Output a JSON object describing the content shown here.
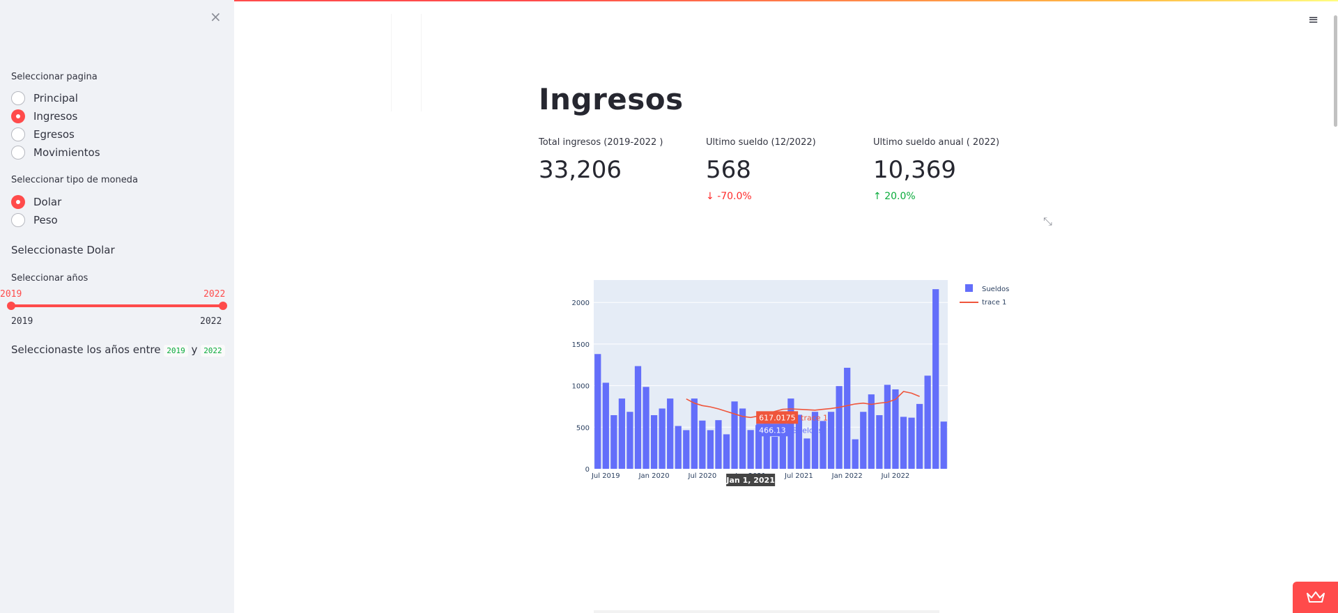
{
  "sidebar": {
    "close_label": "×",
    "page_selector": {
      "label": "Seleccionar pagina",
      "options": [
        "Principal",
        "Ingresos",
        "Egresos",
        "Movimientos"
      ],
      "selected": "Ingresos"
    },
    "currency_selector": {
      "label": "Seleccionar tipo de moneda",
      "options": [
        "Dolar",
        "Peso"
      ],
      "selected": "Dolar"
    },
    "currency_message": "Seleccionaste Dolar",
    "years_slider": {
      "label": "Seleccionar años",
      "value_low": "2019",
      "value_high": "2022",
      "min_label": "2019",
      "max_label": "2022"
    },
    "years_message": {
      "prefix": "Seleccionaste los años entre",
      "start": "2019",
      "connector": "y",
      "end": "2022"
    }
  },
  "header": {
    "menu_icon": "hamburger-icon",
    "menu_glyph": "≡"
  },
  "main": {
    "title": "Ingresos",
    "metrics": [
      {
        "label": "Total ingresos (2019-2022 )",
        "value": "33,206",
        "delta": ""
      },
      {
        "label": "Ultimo sueldo (12/2022)",
        "value": "568",
        "delta": "-70.0%",
        "delta_dir": "down"
      },
      {
        "label": "Ultimo sueldo anual ( 2022)",
        "value": "10,369",
        "delta": "20.0%",
        "delta_dir": "up"
      }
    ],
    "expand_icon": "expand-icon"
  },
  "colors": {
    "accent": "#ff4b4b",
    "bar": "#636efa",
    "line": "#ef553b",
    "positive": "#09ab3b",
    "negative": "#ff2b2b",
    "plot_bg": "#e5ecf6"
  },
  "chart_data": {
    "type": "bar",
    "x": [
      "2019-06",
      "2019-07",
      "2019-08",
      "2019-09",
      "2019-10",
      "2019-11",
      "2019-12",
      "2020-01",
      "2020-02",
      "2020-03",
      "2020-04",
      "2020-05",
      "2020-06",
      "2020-07",
      "2020-08",
      "2020-09",
      "2020-10",
      "2020-11",
      "2020-12",
      "2021-01",
      "2021-02",
      "2021-03",
      "2021-04",
      "2021-05",
      "2021-06",
      "2021-07",
      "2021-08",
      "2021-09",
      "2021-10",
      "2021-11",
      "2021-12",
      "2022-01",
      "2022-02",
      "2022-03",
      "2022-04",
      "2022-05",
      "2022-06",
      "2022-07",
      "2022-08",
      "2022-09",
      "2022-10",
      "2022-11",
      "2022-12"
    ],
    "series": [
      {
        "name": "Sueldos",
        "type": "bar",
        "values": [
          1380,
          1035,
          645,
          845,
          685,
          1235,
          985,
          645,
          725,
          845,
          515,
          465,
          845,
          580,
          465,
          585,
          415,
          810,
          725,
          466.13,
          525,
          565,
          385,
          585,
          845,
          650,
          365,
          685,
          575,
          685,
          995,
          1215,
          355,
          685,
          895,
          645,
          1010,
          955,
          625,
          615,
          780,
          1120,
          2160,
          568
        ]
      },
      {
        "name": "trace 1",
        "type": "line",
        "start_index": 11,
        "values": [
          840,
          790,
          760,
          745,
          720,
          690,
          660,
          630,
          617.0175,
          635,
          655,
          690,
          715,
          720,
          715,
          710,
          705,
          715,
          725,
          740,
          760,
          780,
          790,
          775,
          790,
          800,
          835,
          930,
          910,
          870
        ]
      }
    ],
    "x_tick_labels": [
      "Jul 2019",
      "Jan 2020",
      "Jul 2020",
      "Jan 2021",
      "Jul 2021",
      "Jan 2022",
      "Jul 2022"
    ],
    "y_tick_labels": [
      "0",
      "500",
      "1000",
      "1500",
      "2000"
    ],
    "ylim": [
      0,
      2270
    ],
    "grid": true,
    "legend_position": "right",
    "hover": {
      "x_label": "Jan 1, 2021",
      "trace1_value": "617.0175",
      "trace1_name": "trace 1",
      "bar_value": "466.13",
      "bar_name": "Sueldos"
    }
  }
}
